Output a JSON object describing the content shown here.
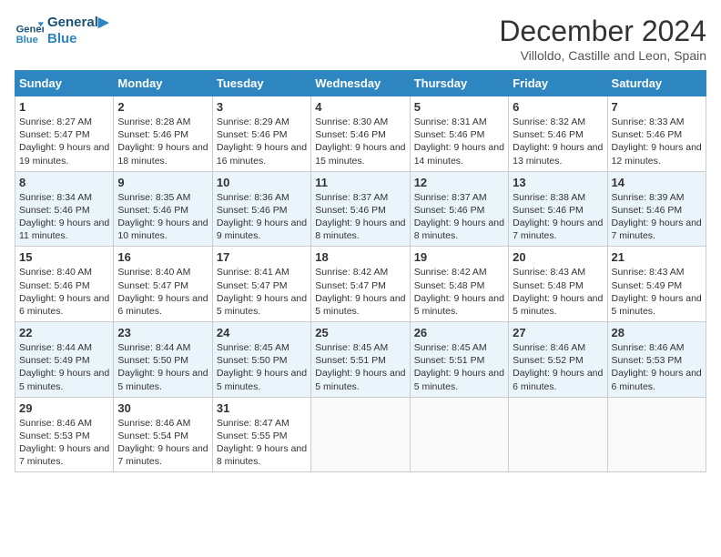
{
  "header": {
    "logo_line1": "General",
    "logo_line2": "Blue",
    "month_title": "December 2024",
    "subtitle": "Villoldo, Castille and Leon, Spain"
  },
  "days_of_week": [
    "Sunday",
    "Monday",
    "Tuesday",
    "Wednesday",
    "Thursday",
    "Friday",
    "Saturday"
  ],
  "weeks": [
    [
      {
        "day": "1",
        "sunrise": "8:27 AM",
        "sunset": "5:47 PM",
        "daylight": "9 hours and 19 minutes."
      },
      {
        "day": "2",
        "sunrise": "8:28 AM",
        "sunset": "5:46 PM",
        "daylight": "9 hours and 18 minutes."
      },
      {
        "day": "3",
        "sunrise": "8:29 AM",
        "sunset": "5:46 PM",
        "daylight": "9 hours and 16 minutes."
      },
      {
        "day": "4",
        "sunrise": "8:30 AM",
        "sunset": "5:46 PM",
        "daylight": "9 hours and 15 minutes."
      },
      {
        "day": "5",
        "sunrise": "8:31 AM",
        "sunset": "5:46 PM",
        "daylight": "9 hours and 14 minutes."
      },
      {
        "day": "6",
        "sunrise": "8:32 AM",
        "sunset": "5:46 PM",
        "daylight": "9 hours and 13 minutes."
      },
      {
        "day": "7",
        "sunrise": "8:33 AM",
        "sunset": "5:46 PM",
        "daylight": "9 hours and 12 minutes."
      }
    ],
    [
      {
        "day": "8",
        "sunrise": "8:34 AM",
        "sunset": "5:46 PM",
        "daylight": "9 hours and 11 minutes."
      },
      {
        "day": "9",
        "sunrise": "8:35 AM",
        "sunset": "5:46 PM",
        "daylight": "9 hours and 10 minutes."
      },
      {
        "day": "10",
        "sunrise": "8:36 AM",
        "sunset": "5:46 PM",
        "daylight": "9 hours and 9 minutes."
      },
      {
        "day": "11",
        "sunrise": "8:37 AM",
        "sunset": "5:46 PM",
        "daylight": "9 hours and 8 minutes."
      },
      {
        "day": "12",
        "sunrise": "8:37 AM",
        "sunset": "5:46 PM",
        "daylight": "9 hours and 8 minutes."
      },
      {
        "day": "13",
        "sunrise": "8:38 AM",
        "sunset": "5:46 PM",
        "daylight": "9 hours and 7 minutes."
      },
      {
        "day": "14",
        "sunrise": "8:39 AM",
        "sunset": "5:46 PM",
        "daylight": "9 hours and 7 minutes."
      }
    ],
    [
      {
        "day": "15",
        "sunrise": "8:40 AM",
        "sunset": "5:46 PM",
        "daylight": "9 hours and 6 minutes."
      },
      {
        "day": "16",
        "sunrise": "8:40 AM",
        "sunset": "5:47 PM",
        "daylight": "9 hours and 6 minutes."
      },
      {
        "day": "17",
        "sunrise": "8:41 AM",
        "sunset": "5:47 PM",
        "daylight": "9 hours and 5 minutes."
      },
      {
        "day": "18",
        "sunrise": "8:42 AM",
        "sunset": "5:47 PM",
        "daylight": "9 hours and 5 minutes."
      },
      {
        "day": "19",
        "sunrise": "8:42 AM",
        "sunset": "5:48 PM",
        "daylight": "9 hours and 5 minutes."
      },
      {
        "day": "20",
        "sunrise": "8:43 AM",
        "sunset": "5:48 PM",
        "daylight": "9 hours and 5 minutes."
      },
      {
        "day": "21",
        "sunrise": "8:43 AM",
        "sunset": "5:49 PM",
        "daylight": "9 hours and 5 minutes."
      }
    ],
    [
      {
        "day": "22",
        "sunrise": "8:44 AM",
        "sunset": "5:49 PM",
        "daylight": "9 hours and 5 minutes."
      },
      {
        "day": "23",
        "sunrise": "8:44 AM",
        "sunset": "5:50 PM",
        "daylight": "9 hours and 5 minutes."
      },
      {
        "day": "24",
        "sunrise": "8:45 AM",
        "sunset": "5:50 PM",
        "daylight": "9 hours and 5 minutes."
      },
      {
        "day": "25",
        "sunrise": "8:45 AM",
        "sunset": "5:51 PM",
        "daylight": "9 hours and 5 minutes."
      },
      {
        "day": "26",
        "sunrise": "8:45 AM",
        "sunset": "5:51 PM",
        "daylight": "9 hours and 5 minutes."
      },
      {
        "day": "27",
        "sunrise": "8:46 AM",
        "sunset": "5:52 PM",
        "daylight": "9 hours and 6 minutes."
      },
      {
        "day": "28",
        "sunrise": "8:46 AM",
        "sunset": "5:53 PM",
        "daylight": "9 hours and 6 minutes."
      }
    ],
    [
      {
        "day": "29",
        "sunrise": "8:46 AM",
        "sunset": "5:53 PM",
        "daylight": "9 hours and 7 minutes."
      },
      {
        "day": "30",
        "sunrise": "8:46 AM",
        "sunset": "5:54 PM",
        "daylight": "9 hours and 7 minutes."
      },
      {
        "day": "31",
        "sunrise": "8:47 AM",
        "sunset": "5:55 PM",
        "daylight": "9 hours and 8 minutes."
      },
      null,
      null,
      null,
      null
    ]
  ]
}
